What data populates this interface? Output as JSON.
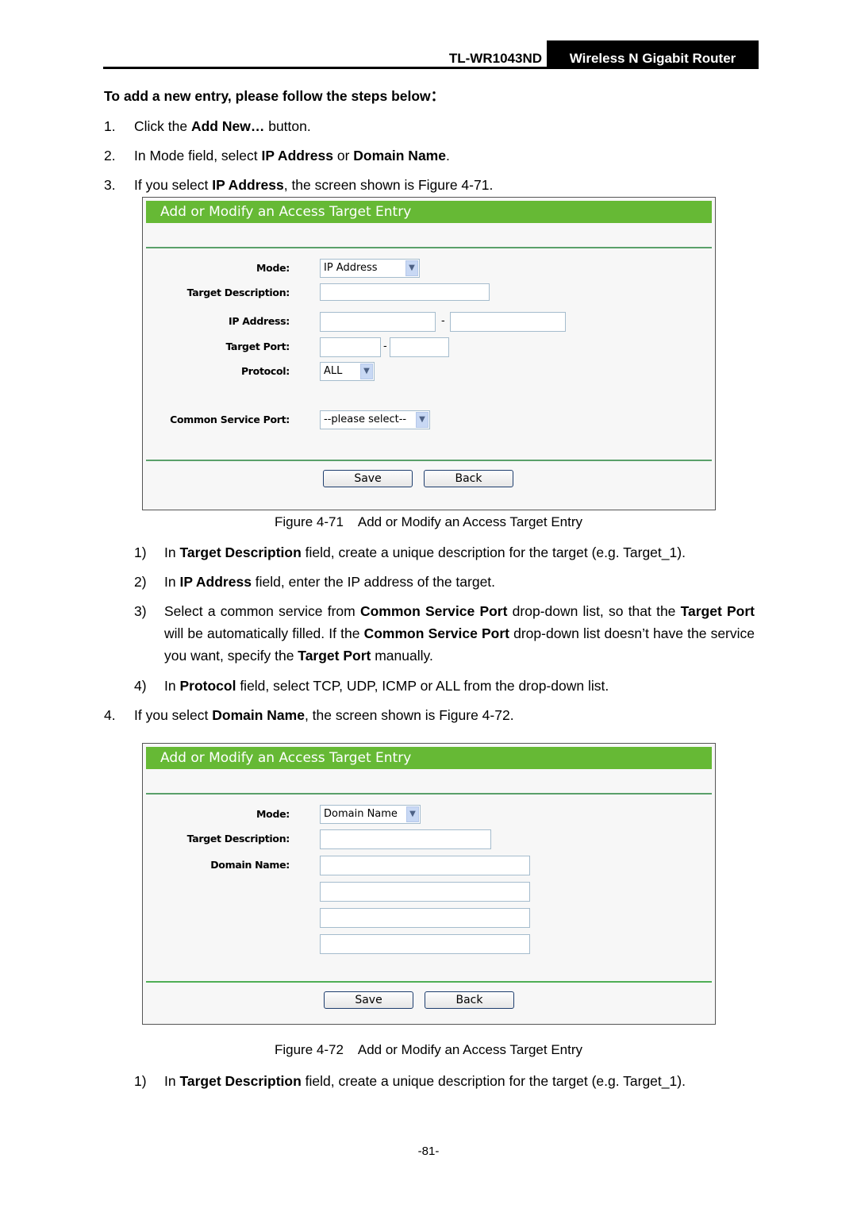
{
  "header": {
    "model": "TL-WR1043ND",
    "product": "Wireless N Gigabit Router"
  },
  "intro": "To add a new entry, please follow the steps below：",
  "steps": [
    {
      "num": "1.",
      "parts": [
        "Click the ",
        "Add New…",
        " button."
      ]
    },
    {
      "num": "2.",
      "parts": [
        "In Mode field, select ",
        "IP Address",
        " or ",
        "Domain Name",
        "."
      ]
    },
    {
      "num": "3.",
      "parts": [
        "If you select ",
        "IP Address",
        ", the screen shown is Figure 4-71."
      ]
    },
    {
      "num": "4.",
      "parts": [
        "If you select ",
        "Domain Name",
        ", the screen shown is Figure 4-72."
      ]
    }
  ],
  "figure1": {
    "title": "Add or Modify an Access Target Entry",
    "labels": {
      "mode": "Mode:",
      "target_description": "Target Description:",
      "ip_address": "IP Address:",
      "target_port": "Target Port:",
      "protocol": "Protocol:",
      "common_service_port": "Common Service Port:"
    },
    "mode_value": "IP Address",
    "protocol_value": "ALL",
    "common_service_value": "--please select--",
    "range_separator": "-",
    "save": "Save",
    "back": "Back",
    "caption": "Figure 4-71    Add or Modify an Access Target Entry"
  },
  "substeps1": [
    {
      "num": "1)",
      "parts": [
        "In ",
        "Target Description",
        " field, create a unique description for the target (e.g. Target_1)."
      ]
    },
    {
      "num": "2)",
      "parts": [
        "In ",
        "IP Address",
        " field, enter the IP address of the target."
      ]
    },
    {
      "num": "3)",
      "parts": [
        "Select a common service from ",
        "Common Service Port",
        " drop-down list, so that the ",
        "Target Port",
        " will be automatically filled. If the ",
        "Common Service Port",
        " drop-down list doesn’t have the service you want, specify the ",
        "Target Port",
        " manually."
      ]
    },
    {
      "num": "4)",
      "parts": [
        "In ",
        "Protocol",
        " field, select TCP, UDP, ICMP or ALL from the drop-down list."
      ]
    }
  ],
  "figure2": {
    "title": "Add or Modify an Access Target Entry",
    "labels": {
      "mode": "Mode:",
      "target_description": "Target Description:",
      "domain_name": "Domain Name:"
    },
    "mode_value": "Domain Name",
    "save": "Save",
    "back": "Back",
    "caption": "Figure 4-72    Add or Modify an Access Target Entry"
  },
  "substeps2": [
    {
      "num": "1)",
      "parts": [
        "In ",
        "Target Description",
        " field, create a unique description for the target (e.g. Target_1)."
      ]
    }
  ],
  "page_number": "-81-",
  "colors": {
    "title_bar": "#66b935",
    "separator": "#5aa06a",
    "input_border": "#a5bccd"
  }
}
